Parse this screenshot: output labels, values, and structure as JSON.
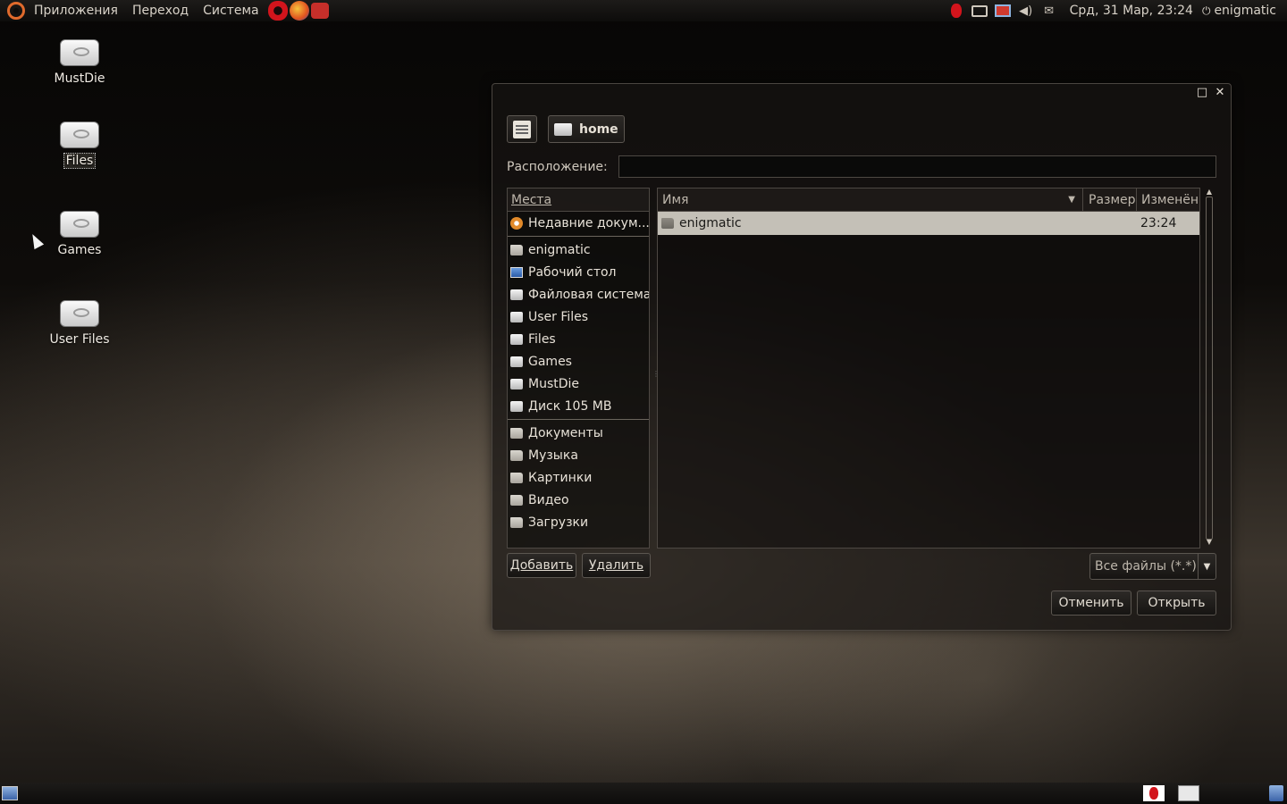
{
  "top_panel": {
    "menus": [
      "Приложения",
      "Переход",
      "Система"
    ],
    "clock": "Срд, 31 Мар, 23:24",
    "user": "enigmatic",
    "launchers": [
      "opera-icon",
      "firefox-icon",
      "phone-icon"
    ],
    "tray_icons": [
      "opera-tray-icon",
      "display-icon",
      "network-icon",
      "volume-icon",
      "mail-icon"
    ]
  },
  "desktop": {
    "icons": [
      {
        "label": "MustDie",
        "icon": "drive-icon"
      },
      {
        "label": "Files",
        "icon": "drive-icon",
        "selected": true
      },
      {
        "label": "Games",
        "icon": "drive-icon"
      },
      {
        "label": "User Files",
        "icon": "drive-icon"
      }
    ]
  },
  "dialog": {
    "path": {
      "edit_icon": "edit-location-icon",
      "current": "home"
    },
    "location": {
      "label": "Расположение:",
      "value": ""
    },
    "places": {
      "header": "Места",
      "items": [
        {
          "label": "Недавние докум...",
          "icon": "recent-icon",
          "group": 1
        },
        {
          "label": "enigmatic",
          "icon": "home-folder-icon",
          "group": 2
        },
        {
          "label": "Рабочий стол",
          "icon": "desktop-icon",
          "group": 2
        },
        {
          "label": "Файловая система",
          "icon": "drive-icon",
          "group": 2
        },
        {
          "label": "User Files",
          "icon": "drive-icon",
          "group": 2
        },
        {
          "label": "Files",
          "icon": "drive-icon",
          "group": 2
        },
        {
          "label": "Games",
          "icon": "drive-icon",
          "group": 2
        },
        {
          "label": "MustDie",
          "icon": "drive-icon",
          "group": 2
        },
        {
          "label": "Диск 105 MB",
          "icon": "drive-icon",
          "group": 2
        },
        {
          "label": "Документы",
          "icon": "folder-icon",
          "group": 3
        },
        {
          "label": "Музыка",
          "icon": "folder-icon",
          "group": 3
        },
        {
          "label": "Картинки",
          "icon": "folder-icon",
          "group": 3
        },
        {
          "label": "Видео",
          "icon": "folder-icon",
          "group": 3
        },
        {
          "label": "Загрузки",
          "icon": "folder-icon",
          "group": 3
        }
      ],
      "add_label": "Добавить",
      "remove_label": "Удалить"
    },
    "files": {
      "columns": {
        "name": "Имя",
        "size": "Размер",
        "modified": "Изменён"
      },
      "rows": [
        {
          "name": "enigmatic",
          "size": "",
          "modified": "23:24",
          "selected": true
        }
      ]
    },
    "filter": {
      "selected": "Все файлы (*.*)"
    },
    "cancel_label": "Отменить",
    "open_label": "Открыть"
  }
}
